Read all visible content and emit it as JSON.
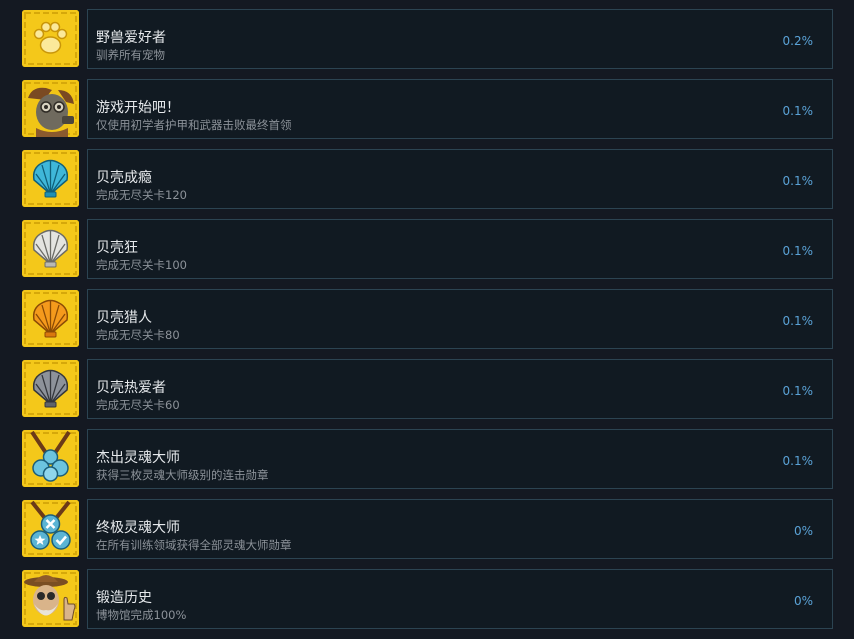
{
  "achievements": [
    {
      "title": "野兽爱好者",
      "desc": "驯养所有宠物",
      "percent": "0.2%",
      "icon": "paw-icon"
    },
    {
      "title": "游戏开始吧！",
      "desc": "仅使用初学者护甲和武器击败最终首领",
      "percent": "0.1%",
      "icon": "gasmask-hero-icon"
    },
    {
      "title": "贝壳成瘾",
      "desc": "完成无尽关卡120",
      "percent": "0.1%",
      "icon": "blue-shell-icon"
    },
    {
      "title": "贝壳狂",
      "desc": "完成无尽关卡100",
      "percent": "0.1%",
      "icon": "silver-shell-icon"
    },
    {
      "title": "贝壳猎人",
      "desc": "完成无尽关卡80",
      "percent": "0.1%",
      "icon": "orange-shell-icon"
    },
    {
      "title": "贝壳热爱者",
      "desc": "完成无尽关卡60",
      "percent": "0.1%",
      "icon": "dark-shell-icon"
    },
    {
      "title": "杰出灵魂大师",
      "desc": "获得三枚灵魂大师级别的连击勋章",
      "percent": "0.1%",
      "icon": "medal-icon"
    },
    {
      "title": "终极灵魂大师",
      "desc": "在所有训练领域获得全部灵魂大师勋章",
      "percent": "0%",
      "icon": "ultimate-medal-icon"
    },
    {
      "title": "锻造历史",
      "desc": "博物馆完成100%",
      "percent": "0%",
      "icon": "museum-curator-icon"
    }
  ]
}
